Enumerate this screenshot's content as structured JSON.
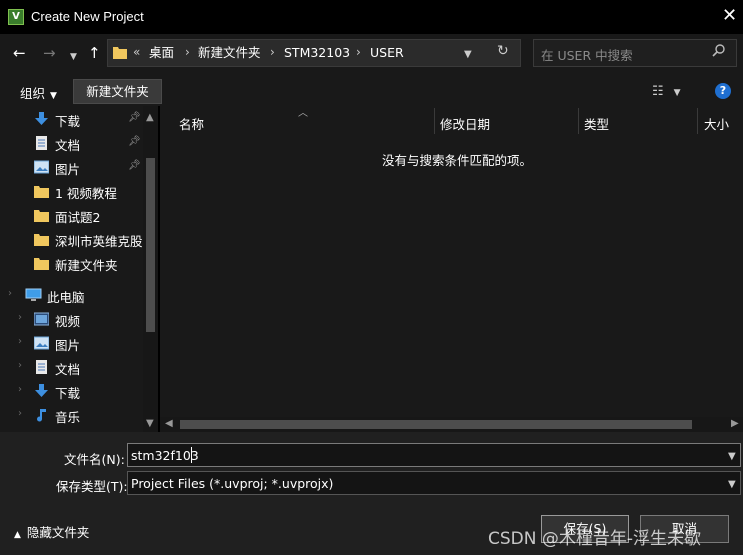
{
  "window": {
    "title": "Create New Project",
    "app_icon_letter": "V"
  },
  "address": {
    "breadcrumb": [
      "桌面",
      "新建文件夹",
      "STM32103",
      "USER"
    ],
    "overflow": "«"
  },
  "search": {
    "placeholder": "在 USER 中搜索"
  },
  "toolbar": {
    "organize_label": "组织",
    "new_folder_label": "新建文件夹",
    "help_label": "?"
  },
  "nav_pane": {
    "quick_access": [
      {
        "label": "下载",
        "icon": "download-arrow-icon",
        "pinned": true
      },
      {
        "label": "文档",
        "icon": "document-icon",
        "pinned": true
      },
      {
        "label": "图片",
        "icon": "picture-icon",
        "pinned": true
      },
      {
        "label": "1 视频教程",
        "icon": "folder-icon"
      },
      {
        "label": "面试题2",
        "icon": "folder-icon"
      },
      {
        "label": "深圳市英维克股份",
        "icon": "folder-icon"
      },
      {
        "label": "新建文件夹",
        "icon": "folder-icon"
      }
    ],
    "this_pc": {
      "label": "此电脑",
      "icon": "computer-icon"
    },
    "pc_items": [
      {
        "label": "视频",
        "icon": "video-icon"
      },
      {
        "label": "图片",
        "icon": "picture-icon"
      },
      {
        "label": "文档",
        "icon": "document-icon"
      },
      {
        "label": "下载",
        "icon": "download-arrow-icon"
      },
      {
        "label": "音乐",
        "icon": "music-note-icon"
      }
    ]
  },
  "file_list": {
    "columns": [
      "名称",
      "修改日期",
      "类型",
      "大小"
    ],
    "empty_message": "没有与搜索条件匹配的项。"
  },
  "form": {
    "filename_label": "文件名(N):",
    "filename_value": "stm32f103",
    "filetype_label": "保存类型(T):",
    "filetype_value": "Project Files (*.uvproj; *.uvprojx)"
  },
  "footer": {
    "hide_folders_label": "隐藏文件夹",
    "save_label": "保存(S)",
    "cancel_label": "取消"
  },
  "watermark": "CSDN @木槿昔年-浮生未歇",
  "colors": {
    "background": "#191919",
    "title_bar": "#000000",
    "accent": "#1f6fd1",
    "folder": "#f0c75e"
  }
}
